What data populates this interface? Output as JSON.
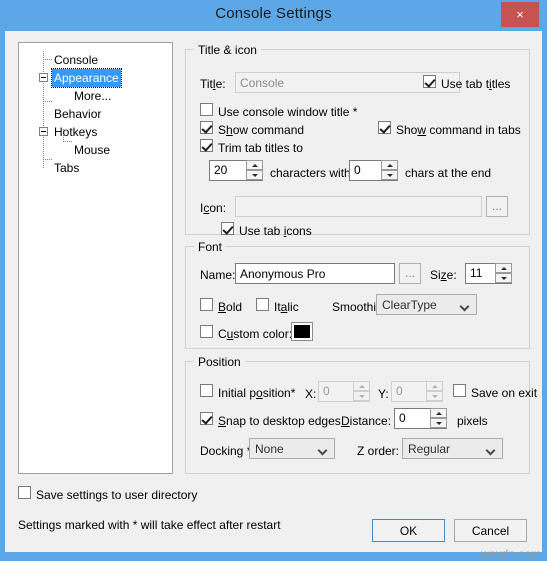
{
  "window": {
    "title": "Console Settings",
    "close_label": "×",
    "accent_title_bar": "#5ba7e8",
    "accent_close": "#c75252",
    "selection_color": "#3399ff"
  },
  "tree": {
    "items": [
      {
        "label": "Console",
        "level": 0,
        "expander": "none",
        "selected": false
      },
      {
        "label": "Appearance",
        "level": 0,
        "expander": "minus",
        "selected": true
      },
      {
        "label": "More...",
        "level": 1,
        "expander": "none",
        "selected": false
      },
      {
        "label": "Behavior",
        "level": 0,
        "expander": "none",
        "selected": false
      },
      {
        "label": "Hotkeys",
        "level": 0,
        "expander": "minus",
        "selected": false
      },
      {
        "label": "Mouse",
        "level": 1,
        "expander": "none",
        "selected": false
      },
      {
        "label": "Tabs",
        "level": 0,
        "expander": "none",
        "selected": false
      }
    ]
  },
  "title_icon": {
    "group_label": "Title & icon",
    "title_label": "Title:",
    "title_value": "Console",
    "use_tab_titles": {
      "label": "Use tab titles",
      "checked": true
    },
    "use_console_window_title": {
      "label": "Use console window title *",
      "checked": false
    },
    "show_command": {
      "label": "Show command",
      "checked": true
    },
    "show_command_in_tabs": {
      "label": "Show command in tabs",
      "checked": true
    },
    "trim_tab_titles": {
      "label": "Trim tab titles to",
      "checked": true
    },
    "trim_chars_value": "20",
    "characters_with_label": "characters with",
    "end_chars_value": "0",
    "chars_at_end_label": "chars at the end",
    "icon_label": "Icon:",
    "icon_value": "",
    "icon_browse_label": "...",
    "use_tab_icons": {
      "label": "Use tab icons",
      "checked": true
    }
  },
  "font": {
    "group_label": "Font",
    "name_label": "Name:",
    "name_value": "Anonymous Pro",
    "name_browse_label": "...",
    "size_label": "Size:",
    "size_value": "11",
    "bold": {
      "label": "Bold",
      "checked": false
    },
    "italic": {
      "label": "Italic",
      "checked": false
    },
    "smoothing_label": "Smoothing:",
    "smoothing_value": "ClearType",
    "custom_color": {
      "label": "Custom color:",
      "checked": false
    },
    "color_swatch": "#000000"
  },
  "position": {
    "group_label": "Position",
    "initial_position": {
      "label": "Initial position*",
      "checked": false
    },
    "x_label": "X:",
    "x_value": "0",
    "y_label": "Y:",
    "y_value": "0",
    "save_on_exit": {
      "label": "Save on exit",
      "checked": false
    },
    "snap_to_edges": {
      "label": "Snap to desktop edges",
      "checked": true
    },
    "distance_label": "Distance:",
    "distance_value": "0",
    "pixels_label": "pixels",
    "docking_label": "Docking *:",
    "docking_value": "None",
    "z_order_label": "Z order:",
    "z_order_value": "Regular"
  },
  "footer": {
    "save_settings": {
      "label": "Save settings to user directory",
      "checked": false
    },
    "restart_note": "Settings marked with * will take effect after restart",
    "ok_label": "OK",
    "cancel_label": "Cancel",
    "watermark": "wsxdn.com"
  }
}
